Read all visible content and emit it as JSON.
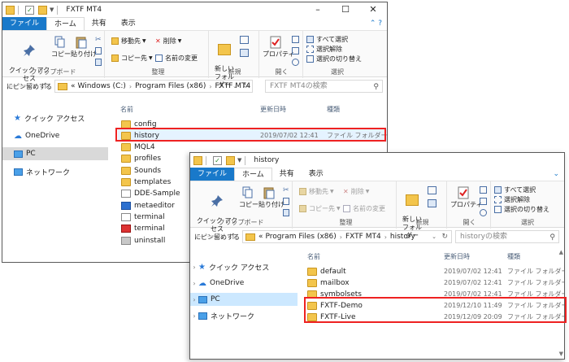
{
  "colors": {
    "file_tab": "#1979ca",
    "folder": "#f3c54c",
    "highlight": "#e22b2b",
    "selection": "#cce8ff"
  },
  "w1": {
    "title": "FXTF MT4",
    "tabs": [
      "ファイル",
      "ホーム",
      "共有",
      "表示"
    ],
    "ribbon": {
      "pin_label": "クイック アクセス\nにピン留めする",
      "copy_label": "コピー",
      "paste_label": "貼り付け",
      "clipboard_group": "クリップボード",
      "move_to": "移動先",
      "copy_to": "コピー先",
      "delete": "削除",
      "rename": "名前の変更",
      "organize_group": "整理",
      "new_folder": "新しい\nフォルダー",
      "new_group": "新規",
      "properties": "プロパティ",
      "open_group": "開く",
      "select_all": "すべて選択",
      "select_none": "選択解除",
      "invert_selection": "選択の切り替え",
      "select_group": "選択"
    },
    "address": [
      "Windows (C:)",
      "Program Files (x86)",
      "FXTF MT4"
    ],
    "address_prefix": "«",
    "search_placeholder": "FXTF MT4の検索",
    "nav": [
      {
        "label": "クイック アクセス",
        "icon": "star-icon"
      },
      {
        "label": "OneDrive",
        "icon": "cloud-icon"
      },
      {
        "label": "PC",
        "icon": "pc-icon"
      },
      {
        "label": "ネットワーク",
        "icon": "network-icon"
      }
    ],
    "columns": {
      "name": "名前",
      "date": "更新日時",
      "type": "種類"
    },
    "files": [
      {
        "name": "config",
        "date": "",
        "type": "",
        "icon": "folder"
      },
      {
        "name": "history",
        "date": "2019/07/02 12:41",
        "type": "ファイル フォルダー",
        "icon": "folder"
      },
      {
        "name": "MQL4",
        "date": "",
        "type": "",
        "icon": "folder"
      },
      {
        "name": "profiles",
        "date": "",
        "type": "",
        "icon": "folder"
      },
      {
        "name": "Sounds",
        "date": "",
        "type": "",
        "icon": "folder"
      },
      {
        "name": "templates",
        "date": "",
        "type": "",
        "icon": "folder"
      },
      {
        "name": "DDE-Sample",
        "date": "",
        "type": "",
        "icon": "file"
      },
      {
        "name": "metaeditor",
        "date": "",
        "type": "",
        "icon": "app-blue"
      },
      {
        "name": "terminal",
        "date": "",
        "type": "",
        "icon": "file"
      },
      {
        "name": "terminal",
        "date": "",
        "type": "",
        "icon": "app-red"
      },
      {
        "name": "uninstall",
        "date": "",
        "type": "",
        "icon": "app-gray"
      }
    ]
  },
  "w2": {
    "title": "history",
    "tabs": [
      "ファイル",
      "ホーム",
      "共有",
      "表示"
    ],
    "ribbon": {
      "pin_label": "クイック アクセス\nにピン留めする",
      "copy_label": "コピー",
      "paste_label": "貼り付け",
      "clipboard_group": "クリップボード",
      "move_to": "移動先",
      "copy_to": "コピー先",
      "delete": "削除",
      "rename": "名前の変更",
      "organize_group": "整理",
      "new_folder": "新しい\nフォルダー",
      "new_group": "新規",
      "properties": "プロパティ",
      "open_group": "開く",
      "select_all": "すべて選択",
      "select_none": "選択解除",
      "invert_selection": "選択の切り替え",
      "select_group": "選択"
    },
    "address": [
      "Program Files (x86)",
      "FXTF MT4",
      "history"
    ],
    "address_prefix": "«",
    "search_placeholder": "historyの検索",
    "nav": [
      {
        "label": "クイック アクセス",
        "icon": "star-icon"
      },
      {
        "label": "OneDrive",
        "icon": "cloud-icon"
      },
      {
        "label": "PC",
        "icon": "pc-icon"
      },
      {
        "label": "ネットワーク",
        "icon": "network-icon"
      }
    ],
    "columns": {
      "name": "名前",
      "date": "更新日時",
      "type": "種類"
    },
    "files": [
      {
        "name": "default",
        "date": "2019/07/02 12:41",
        "type": "ファイル フォルダー",
        "icon": "folder"
      },
      {
        "name": "mailbox",
        "date": "2019/07/02 12:41",
        "type": "ファイル フォルダー",
        "icon": "folder"
      },
      {
        "name": "symbolsets",
        "date": "2019/07/02 12:41",
        "type": "ファイル フォルダー",
        "icon": "folder"
      },
      {
        "name": "FXTF-Demo",
        "date": "2019/12/10 11:49",
        "type": "ファイル フォルダー",
        "icon": "folder"
      },
      {
        "name": "FXTF-Live",
        "date": "2019/12/09 20:09",
        "type": "ファイル フォルダー",
        "icon": "folder"
      }
    ]
  }
}
